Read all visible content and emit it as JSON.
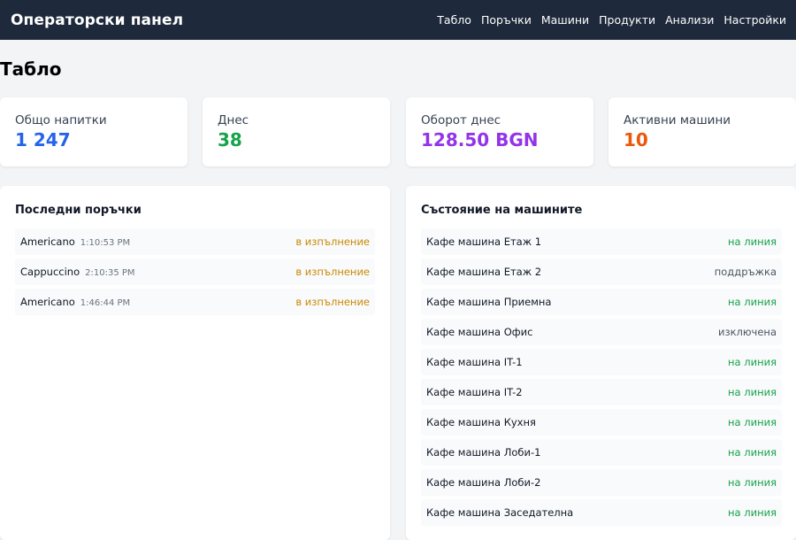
{
  "header": {
    "title": "Операторски панел",
    "nav": [
      "Табло",
      "Поръчки",
      "Машини",
      "Продукти",
      "Анализи",
      "Настройки"
    ]
  },
  "page": {
    "title": "Табло"
  },
  "stats": [
    {
      "label": "Общо напитки",
      "value": "1 247",
      "color": "#2563eb"
    },
    {
      "label": "Днес",
      "value": "38",
      "color": "#16a34a"
    },
    {
      "label": "Оборот днес",
      "value": "128.50 BGN",
      "color": "#9333ea"
    },
    {
      "label": "Активни машини",
      "value": "10",
      "color": "#ea580c"
    }
  ],
  "orders": {
    "title": "Последни поръчки",
    "items": [
      {
        "name": "Americano",
        "time": "1:10:53 PM",
        "status": "в изпълнение"
      },
      {
        "name": "Cappuccino",
        "time": "2:10:35 PM",
        "status": "в изпълнение"
      },
      {
        "name": "Americano",
        "time": "1:46:44 PM",
        "status": "в изпълнение"
      }
    ]
  },
  "machines": {
    "title": "Състояние на машините",
    "items": [
      {
        "name": "Кафе машина Етаж 1",
        "status": "на линия"
      },
      {
        "name": "Кафе машина Етаж 2",
        "status": "поддръжка"
      },
      {
        "name": "Кафе машина Приемна",
        "status": "на линия"
      },
      {
        "name": "Кафе машина Офис",
        "status": "изключена"
      },
      {
        "name": "Кафе машина IT-1",
        "status": "на линия"
      },
      {
        "name": "Кафе машина IT-2",
        "status": "на линия"
      },
      {
        "name": "Кафе машина Кухня",
        "status": "на линия"
      },
      {
        "name": "Кафе машина Лоби-1",
        "status": "на линия"
      },
      {
        "name": "Кафе машина Лоби-2",
        "status": "на линия"
      },
      {
        "name": "Кафе машина Заседателна",
        "status": "на линия"
      }
    ]
  },
  "colors": {
    "header_bg": "#1e293b",
    "status_in_progress": "#ca8a04",
    "status_online": "#16a34a",
    "status_neutral": "#4b5563"
  }
}
